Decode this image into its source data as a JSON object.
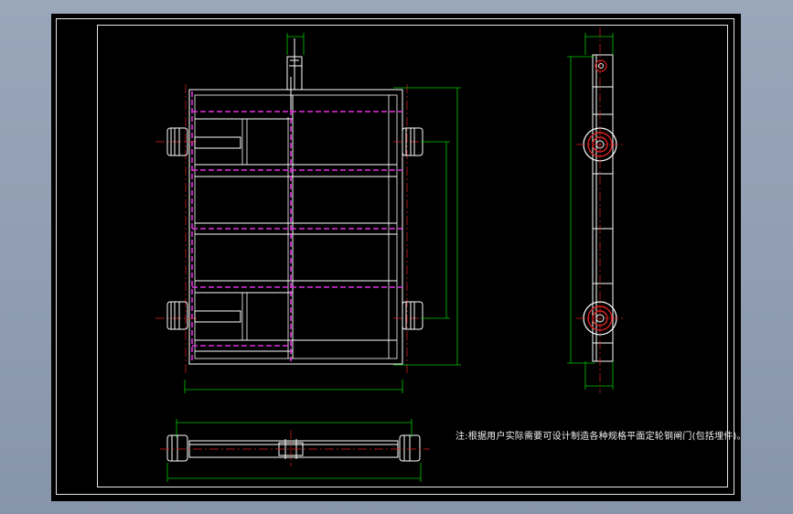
{
  "drawing": {
    "note": "注:根据用户实际需要可设计制造各种规格平面定轮钢闸门(包括埋件)。",
    "colors": {
      "background": "#000000",
      "outline": "#ffffff",
      "hidden_line": "#e030e0",
      "dimension": "#00d000",
      "center_line": "#e02020"
    }
  }
}
